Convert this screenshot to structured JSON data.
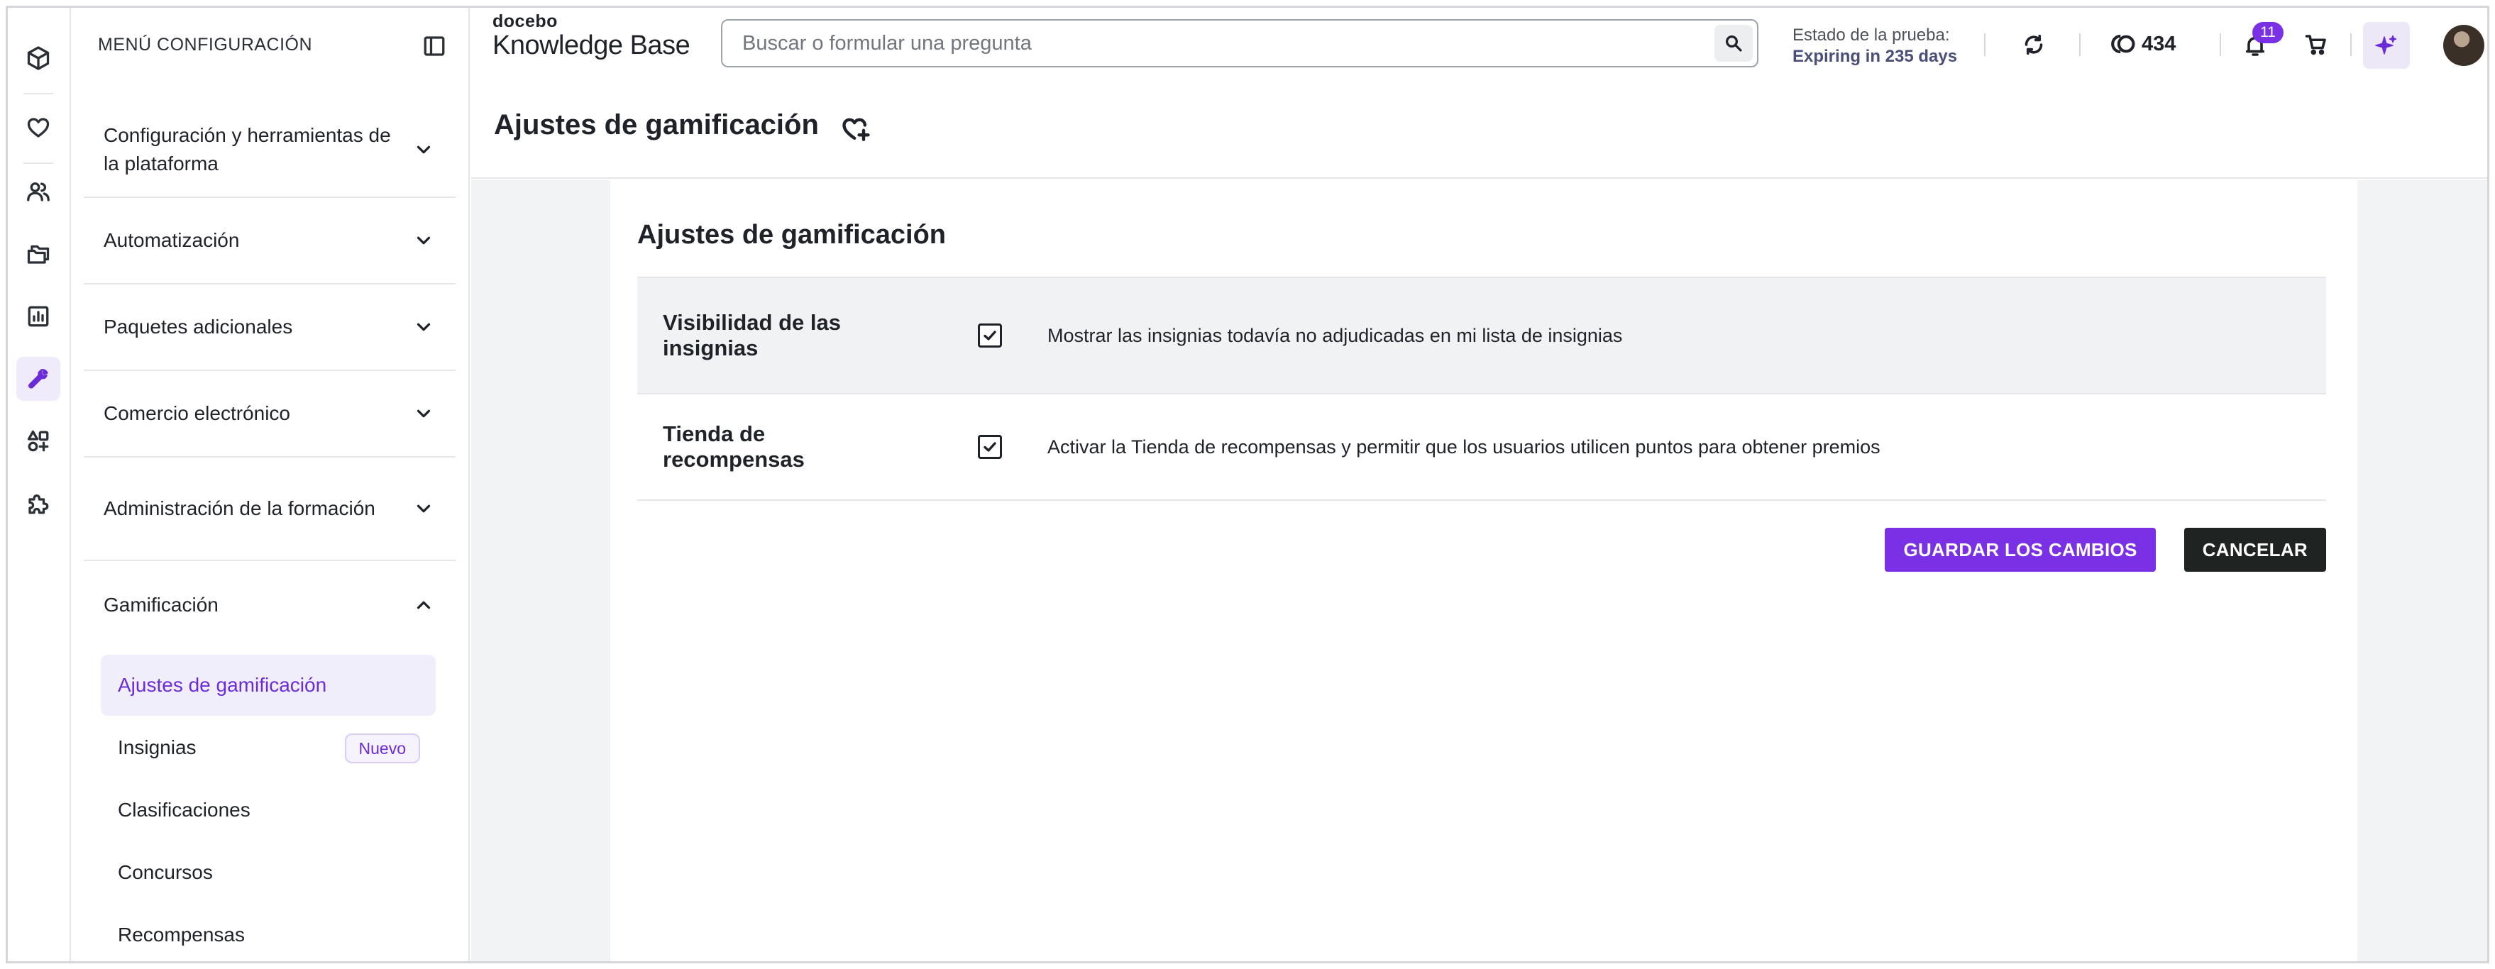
{
  "sidebar": {
    "title": "MENÚ CONFIGURACIÓN",
    "sections": [
      {
        "label": "Configuración y herramientas de la plataforma",
        "expanded": false
      },
      {
        "label": "Automatización",
        "expanded": false
      },
      {
        "label": "Paquetes adicionales",
        "expanded": false
      },
      {
        "label": "Comercio electrónico",
        "expanded": false
      },
      {
        "label": "Administración de la formación",
        "expanded": false
      },
      {
        "label": "Gamificación",
        "expanded": true
      }
    ],
    "subitems": [
      {
        "label": "Ajustes de gamificación",
        "active": true
      },
      {
        "label": "Insignias",
        "badge": "Nuevo"
      },
      {
        "label": "Clasificaciones"
      },
      {
        "label": "Concursos"
      },
      {
        "label": "Recompensas"
      }
    ]
  },
  "rail": {
    "icons": [
      "cube-icon",
      "heart-icon",
      "users-icon",
      "folders-icon",
      "chart-icon",
      "wrench-icon",
      "shapes-icon",
      "puzzle-icon"
    ],
    "active": "wrench-icon"
  },
  "topbar": {
    "logo_small": "docebo",
    "logo_big": "Knowledge Base",
    "search_placeholder": "Buscar o formular una pregunta",
    "trial_label": "Estado de la prueba:",
    "trial_value": "Expiring in 235 days",
    "coins": "434",
    "notifications": "11"
  },
  "page": {
    "title": "Ajustes de gamificación"
  },
  "card": {
    "title": "Ajustes de gamificación",
    "rows": [
      {
        "label": "Visibilidad de las insignias",
        "checked": true,
        "description": "Mostrar las insignias todavía no adjudicadas en mi lista de insignias"
      },
      {
        "label": "Tienda de recompensas",
        "checked": true,
        "description": "Activar la Tienda de recompensas y permitir que los usuarios utilicen puntos para obtener premios"
      }
    ],
    "save_label": "GUARDAR LOS CAMBIOS",
    "cancel_label": "CANCELAR"
  },
  "colors": {
    "accent": "#7a31e6",
    "accent_text": "#6a2bd9",
    "cancel_bg": "#1f2321"
  }
}
